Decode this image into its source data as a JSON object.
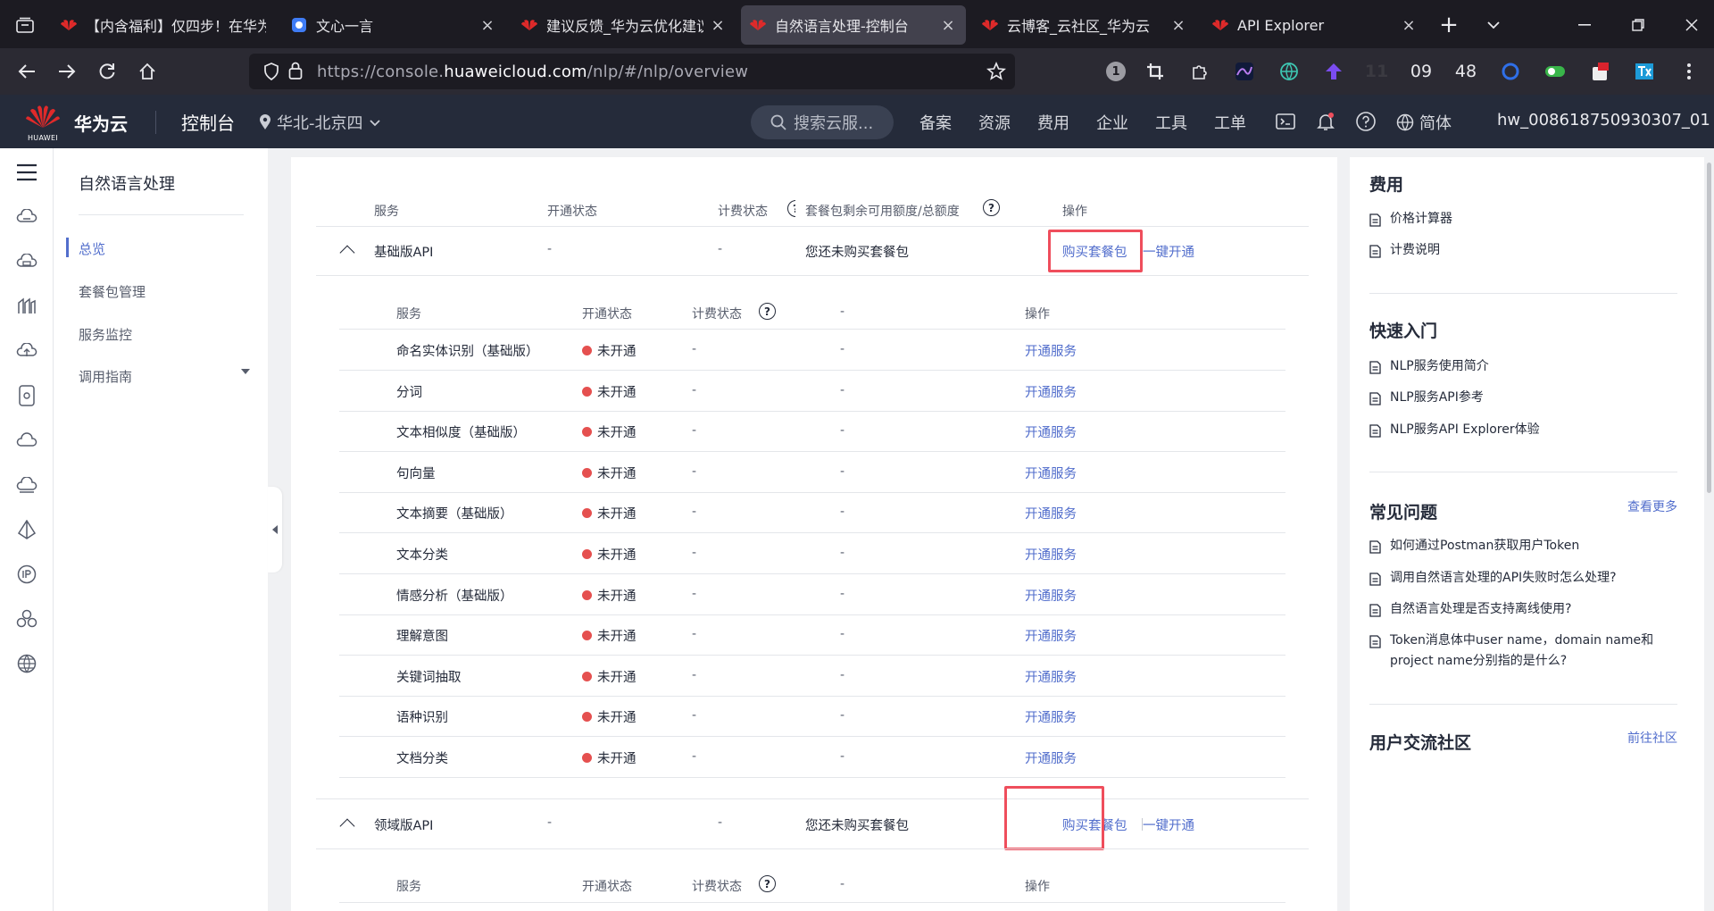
{
  "browser": {
    "tabs": [
      {
        "label": "【内含福利】仅四步！在华为",
        "close": "×"
      },
      {
        "label": "文心一言",
        "close": "×"
      },
      {
        "label": "建议反馈_华为云优化建议反",
        "close": "×"
      },
      {
        "label": "自然语言处理-控制台",
        "close": "×",
        "active": true
      },
      {
        "label": "云博客_云社区_华为云",
        "close": "×"
      },
      {
        "label": "API Explorer",
        "close": "×"
      }
    ],
    "new_tab": "+",
    "url_prefix": "https://console.",
    "url_domain": "huaweicloud.com",
    "url_path": "/nlp/#/nlp/overview",
    "toolbar_badge": "1",
    "clock": [
      "11",
      "09",
      "48"
    ]
  },
  "header": {
    "logo_text": "HUAWEI",
    "brand": "华为云",
    "console": "控制台",
    "region": "华北-北京四",
    "search_placeholder": "搜索云服...",
    "menu": [
      "备案",
      "资源",
      "费用",
      "企业",
      "工具",
      "工单"
    ],
    "lang": "简体",
    "user": "hw_008618750930307_01"
  },
  "subnav": {
    "title": "自然语言处理",
    "items": [
      "总览",
      "套餐包管理",
      "服务监控",
      "调用指南"
    ]
  },
  "main": {
    "top_headers": {
      "service": "服务",
      "open": "开通状态",
      "billing": "计费状态",
      "package": "套餐包剩余可用额度/总额度",
      "action": "操作"
    },
    "groups": [
      {
        "name": "基础版API",
        "open": "-",
        "billing": "-",
        "package": "您还未购买套餐包",
        "buy": "购买套餐包",
        "oneclick": "一键开通"
      },
      {
        "name": "领域版API",
        "open": "-",
        "billing": "-",
        "package": "您还未购买套餐包",
        "buy": "购买套餐包",
        "oneclick": "一键开通"
      }
    ],
    "sub_headers": {
      "service": "服务",
      "open": "开通状态",
      "billing": "计费状态",
      "dash": "-",
      "action": "操作"
    },
    "rows": [
      {
        "service": "命名实体识别（基础版）",
        "status": "未开通",
        "billing": "-",
        "quota": "-",
        "action": "开通服务"
      },
      {
        "service": "分词",
        "status": "未开通",
        "billing": "-",
        "quota": "-",
        "action": "开通服务"
      },
      {
        "service": "文本相似度（基础版）",
        "status": "未开通",
        "billing": "-",
        "quota": "-",
        "action": "开通服务"
      },
      {
        "service": "句向量",
        "status": "未开通",
        "billing": "-",
        "quota": "-",
        "action": "开通服务"
      },
      {
        "service": "文本摘要（基础版）",
        "status": "未开通",
        "billing": "-",
        "quota": "-",
        "action": "开通服务"
      },
      {
        "service": "文本分类",
        "status": "未开通",
        "billing": "-",
        "quota": "-",
        "action": "开通服务"
      },
      {
        "service": "情感分析（基础版）",
        "status": "未开通",
        "billing": "-",
        "quota": "-",
        "action": "开通服务"
      },
      {
        "service": "理解意图",
        "status": "未开通",
        "billing": "-",
        "quota": "-",
        "action": "开通服务"
      },
      {
        "service": "关键词抽取",
        "status": "未开通",
        "billing": "-",
        "quota": "-",
        "action": "开通服务"
      },
      {
        "service": "语种识别",
        "status": "未开通",
        "billing": "-",
        "quota": "-",
        "action": "开通服务"
      },
      {
        "service": "文档分类",
        "status": "未开通",
        "billing": "-",
        "quota": "-",
        "action": "开通服务"
      }
    ]
  },
  "side": {
    "fees_title": "费用",
    "fees_links": [
      "价格计算器",
      "计费说明"
    ],
    "quick_title": "快速入门",
    "quick_links": [
      "NLP服务使用简介",
      "NLP服务API参考",
      "NLP服务API Explorer体验"
    ],
    "faq_title": "常见问题",
    "faq_more": "查看更多",
    "faq_links": [
      "如何通过Postman获取用户Token",
      "调用自然语言处理的API失败时怎么处理?",
      "自然语言处理是否支持离线使用?",
      "Token消息体中user name，domain name和project name分别指的是什么?"
    ],
    "community_title": "用户交流社区",
    "community_more": "前往社区"
  },
  "colors": {
    "accent": "#526ecc",
    "highlight_box": "#ef4e5c",
    "status_dot": "#e5504f",
    "header_bg": "#252b3a"
  }
}
